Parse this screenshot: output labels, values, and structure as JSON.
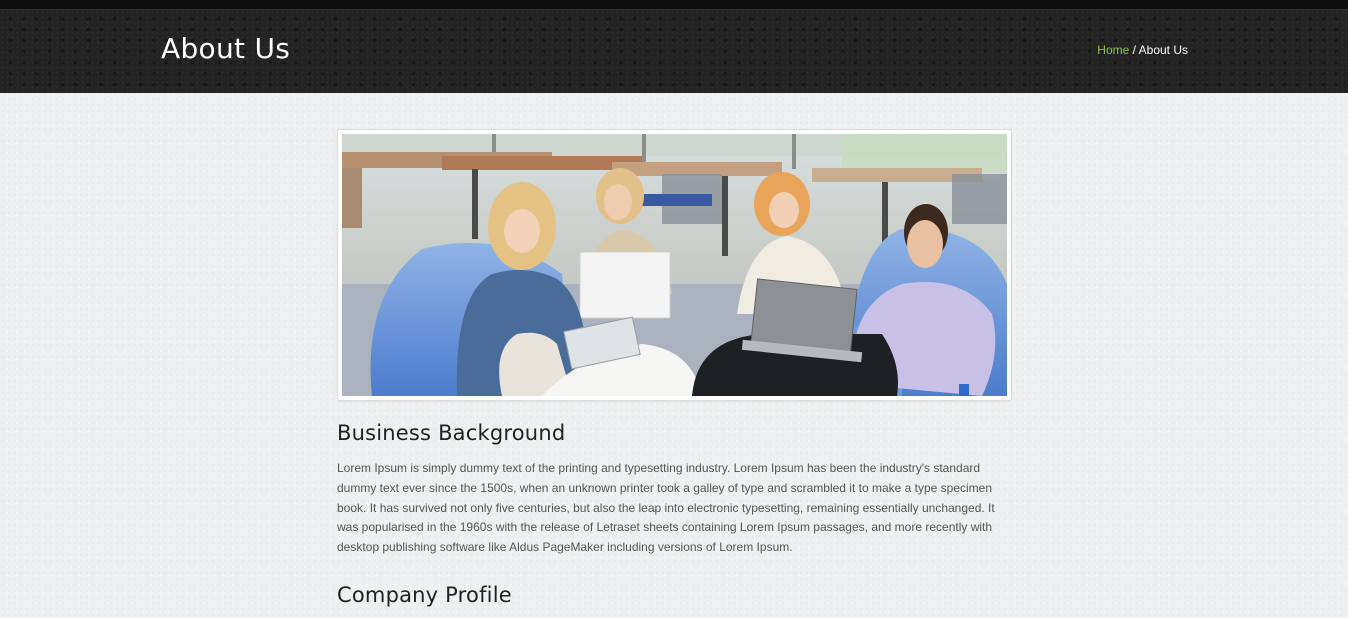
{
  "header": {
    "title": "About Us",
    "breadcrumb": {
      "home": "Home",
      "separator": " / ",
      "current": "About Us"
    }
  },
  "hero_image": {
    "alt": "Group of students with laptops on bean bags",
    "frame_color": "#ffffff"
  },
  "sections": [
    {
      "heading": "Business Background",
      "text": "Lorem Ipsum is simply dummy text of the printing and typesetting industry. Lorem Ipsum has been the industry's standard dummy text ever since the 1500s, when an unknown printer took a galley of type and scrambled it to make a type specimen book. It has survived not only five centuries, but also the leap into electronic typesetting, remaining essentially unchanged. It was popularised in the 1960s with the release of Letraset sheets containing Lorem Ipsum passages, and more recently with desktop publishing software like Aldus PageMaker including versions of Lorem Ipsum."
    },
    {
      "heading": "Company Profile"
    }
  ],
  "colors": {
    "header_bg": "#232323",
    "link_green": "#8cc63f",
    "page_bg": "#eff0f1",
    "text": "#555555"
  }
}
